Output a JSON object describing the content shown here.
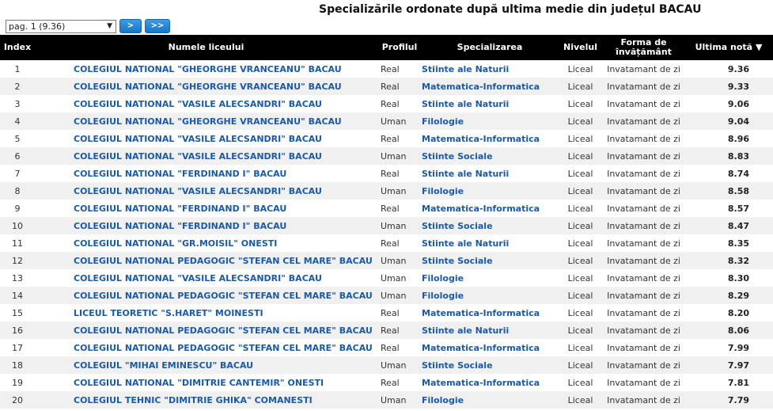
{
  "header": {
    "title": "Specializările ordonate după ultima medie din județul BACAU",
    "page_select_value": "pag. 1 (9.36)",
    "next_label": ">",
    "last_label": ">>"
  },
  "table": {
    "columns": {
      "index": "Index",
      "school": "Numele liceului",
      "profile": "Profilul",
      "specialization": "Specializarea",
      "level": "Nivelul",
      "form": "Forma de învățământ",
      "grade": "Ultima notă ▼"
    },
    "rows": [
      {
        "index": "1",
        "school": "COLEGIUL NATIONAL \"GHEORGHE VRANCEANU\" BACAU",
        "profile": "Real",
        "specialization": "Stiinte ale Naturii",
        "level": "Liceal",
        "form": "Invatamant de zi",
        "grade": "9.36"
      },
      {
        "index": "2",
        "school": "COLEGIUL NATIONAL \"GHEORGHE VRANCEANU\" BACAU",
        "profile": "Real",
        "specialization": "Matematica-Informatica",
        "level": "Liceal",
        "form": "Invatamant de zi",
        "grade": "9.33"
      },
      {
        "index": "3",
        "school": "COLEGIUL NATIONAL \"VASILE ALECSANDRI\" BACAU",
        "profile": "Real",
        "specialization": "Stiinte ale Naturii",
        "level": "Liceal",
        "form": "Invatamant de zi",
        "grade": "9.06"
      },
      {
        "index": "4",
        "school": "COLEGIUL NATIONAL \"GHEORGHE VRANCEANU\" BACAU",
        "profile": "Uman",
        "specialization": "Filologie",
        "level": "Liceal",
        "form": "Invatamant de zi",
        "grade": "9.04"
      },
      {
        "index": "5",
        "school": "COLEGIUL NATIONAL \"VASILE ALECSANDRI\" BACAU",
        "profile": "Real",
        "specialization": "Matematica-Informatica",
        "level": "Liceal",
        "form": "Invatamant de zi",
        "grade": "8.96"
      },
      {
        "index": "6",
        "school": "COLEGIUL NATIONAL \"VASILE ALECSANDRI\" BACAU",
        "profile": "Uman",
        "specialization": "Stiinte Sociale",
        "level": "Liceal",
        "form": "Invatamant de zi",
        "grade": "8.83"
      },
      {
        "index": "7",
        "school": "COLEGIUL NATIONAL \"FERDINAND I\" BACAU",
        "profile": "Real",
        "specialization": "Stiinte ale Naturii",
        "level": "Liceal",
        "form": "Invatamant de zi",
        "grade": "8.74"
      },
      {
        "index": "8",
        "school": "COLEGIUL NATIONAL \"VASILE ALECSANDRI\" BACAU",
        "profile": "Uman",
        "specialization": "Filologie",
        "level": "Liceal",
        "form": "Invatamant de zi",
        "grade": "8.58"
      },
      {
        "index": "9",
        "school": "COLEGIUL NATIONAL \"FERDINAND I\" BACAU",
        "profile": "Real",
        "specialization": "Matematica-Informatica",
        "level": "Liceal",
        "form": "Invatamant de zi",
        "grade": "8.57"
      },
      {
        "index": "10",
        "school": "COLEGIUL NATIONAL \"FERDINAND I\" BACAU",
        "profile": "Uman",
        "specialization": "Stiinte Sociale",
        "level": "Liceal",
        "form": "Invatamant de zi",
        "grade": "8.47"
      },
      {
        "index": "11",
        "school": "COLEGIUL NATIONAL \"GR.MOISIL\" ONESTI",
        "profile": "Real",
        "specialization": "Stiinte ale Naturii",
        "level": "Liceal",
        "form": "Invatamant de zi",
        "grade": "8.35"
      },
      {
        "index": "12",
        "school": "COLEGIUL NATIONAL PEDAGOGIC \"STEFAN CEL MARE\" BACAU",
        "profile": "Uman",
        "specialization": "Stiinte Sociale",
        "level": "Liceal",
        "form": "Invatamant de zi",
        "grade": "8.32"
      },
      {
        "index": "13",
        "school": "COLEGIUL NATIONAL \"VASILE ALECSANDRI\" BACAU",
        "profile": "Uman",
        "specialization": "Filologie",
        "level": "Liceal",
        "form": "Invatamant de zi",
        "grade": "8.30"
      },
      {
        "index": "14",
        "school": "COLEGIUL NATIONAL PEDAGOGIC \"STEFAN CEL MARE\" BACAU",
        "profile": "Uman",
        "specialization": "Filologie",
        "level": "Liceal",
        "form": "Invatamant de zi",
        "grade": "8.29"
      },
      {
        "index": "15",
        "school": "LICEUL TEORETIC \"S.HARET\" MOINESTI",
        "profile": "Real",
        "specialization": "Matematica-Informatica",
        "level": "Liceal",
        "form": "Invatamant de zi",
        "grade": "8.20"
      },
      {
        "index": "16",
        "school": "COLEGIUL NATIONAL PEDAGOGIC \"STEFAN CEL MARE\" BACAU",
        "profile": "Real",
        "specialization": "Stiinte ale Naturii",
        "level": "Liceal",
        "form": "Invatamant de zi",
        "grade": "8.06"
      },
      {
        "index": "17",
        "school": "COLEGIUL NATIONAL PEDAGOGIC \"STEFAN CEL MARE\" BACAU",
        "profile": "Real",
        "specialization": "Matematica-Informatica",
        "level": "Liceal",
        "form": "Invatamant de zi",
        "grade": "7.99"
      },
      {
        "index": "18",
        "school": "COLEGIUL \"MIHAI EMINESCU\" BACAU",
        "profile": "Uman",
        "specialization": "Stiinte Sociale",
        "level": "Liceal",
        "form": "Invatamant de zi",
        "grade": "7.97"
      },
      {
        "index": "19",
        "school": "COLEGIUL NATIONAL \"DIMITRIE CANTEMIR\" ONESTI",
        "profile": "Real",
        "specialization": "Matematica-Informatica",
        "level": "Liceal",
        "form": "Invatamant de zi",
        "grade": "7.81"
      },
      {
        "index": "20",
        "school": "COLEGIUL TEHNIC \"DIMITRIE GHIKA\" COMANESTI",
        "profile": "Uman",
        "specialization": "Filologie",
        "level": "Liceal",
        "form": "Invatamant de zi",
        "grade": "7.79"
      }
    ]
  }
}
